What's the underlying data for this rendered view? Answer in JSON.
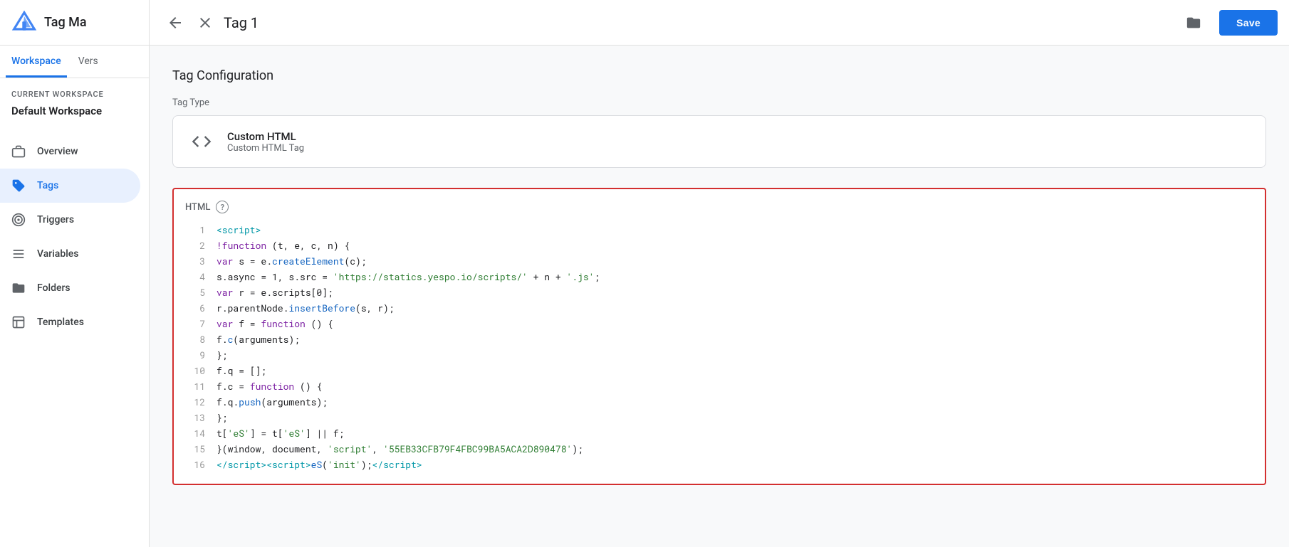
{
  "app": {
    "title": "Tag Ma",
    "logo_alt": "Google Tag Manager"
  },
  "sidebar": {
    "workspace_label": "CURRENT WORKSPACE",
    "workspace_name": "Default Workspace",
    "tabs": [
      {
        "id": "workspace",
        "label": "Workspace",
        "active": true
      },
      {
        "id": "versions",
        "label": "Vers",
        "active": false
      }
    ],
    "nav_items": [
      {
        "id": "overview",
        "label": "Overview",
        "icon": "briefcase",
        "active": false
      },
      {
        "id": "tags",
        "label": "Tags",
        "icon": "tag",
        "active": true
      },
      {
        "id": "triggers",
        "label": "Triggers",
        "icon": "target",
        "active": false
      },
      {
        "id": "variables",
        "label": "Variables",
        "icon": "list",
        "active": false
      },
      {
        "id": "folders",
        "label": "Folders",
        "icon": "folder",
        "active": false
      },
      {
        "id": "templates",
        "label": "Templates",
        "icon": "template",
        "active": false
      }
    ]
  },
  "header": {
    "tag_name": "Tag 1",
    "save_label": "Save"
  },
  "tag_config": {
    "section_title": "Tag Configuration",
    "field_label": "Tag Type",
    "type_name": "Custom HTML",
    "type_sub": "Custom HTML Tag"
  },
  "html_section": {
    "label": "HTML",
    "help": "?",
    "code_lines": [
      {
        "num": 1,
        "html": "<span class='c-tag'>&lt;script&gt;</span>"
      },
      {
        "num": 2,
        "html": "<span class='c-plain'>    </span><span class='c-keyword'>!function</span><span class='c-plain'> (t, e, c, n) {</span>"
      },
      {
        "num": 3,
        "html": "<span class='c-plain'>        </span><span class='c-keyword'>var</span><span class='c-plain'> s = e.</span><span class='c-func'>createElement</span><span class='c-plain'>(c);</span>"
      },
      {
        "num": 4,
        "html": "<span class='c-plain'>        s.async = 1, s.src = </span><span class='c-string'>'https://statics.yespo.io/scripts/'</span><span class='c-plain'> + n + </span><span class='c-string'>'.js'</span><span class='c-plain'>;</span>"
      },
      {
        "num": 5,
        "html": "<span class='c-plain'>        </span><span class='c-keyword'>var</span><span class='c-plain'> r = e.scripts[0];</span>"
      },
      {
        "num": 6,
        "html": "<span class='c-plain'>        r.parentNode.</span><span class='c-func'>insertBefore</span><span class='c-plain'>(s, r);</span>"
      },
      {
        "num": 7,
        "html": "<span class='c-plain'>        </span><span class='c-keyword'>var</span><span class='c-plain'> f = </span><span class='c-keyword'>function</span><span class='c-plain'> () {</span>"
      },
      {
        "num": 8,
        "html": "<span class='c-plain'>            f.</span><span class='c-func'>c</span><span class='c-plain'>(arguments);</span>"
      },
      {
        "num": 9,
        "html": "<span class='c-plain'>        };</span>"
      },
      {
        "num": 10,
        "html": "<span class='c-plain'>        f.q = [];</span>"
      },
      {
        "num": 11,
        "html": "<span class='c-plain'>        f.c = </span><span class='c-keyword'>function</span><span class='c-plain'> () {</span>"
      },
      {
        "num": 12,
        "html": "<span class='c-plain'>            f.q.</span><span class='c-func'>push</span><span class='c-plain'>(arguments);</span>"
      },
      {
        "num": 13,
        "html": "<span class='c-plain'>        };</span>"
      },
      {
        "num": 14,
        "html": "<span class='c-plain'>        t[</span><span class='c-string'>'eS'</span><span class='c-plain'>] = t[</span><span class='c-string'>'eS'</span><span class='c-plain'>] || f;</span>"
      },
      {
        "num": 15,
        "html": "<span class='c-plain'>    }(window, document, </span><span class='c-string'>'script'</span><span class='c-plain'>, </span><span class='c-string'>'55EB33CFB79F4FBC99BA5ACA2D890478'</span><span class='c-plain'>);</span>"
      },
      {
        "num": 16,
        "html": "<span class='c-tag'>&lt;/script&gt;</span><span class='c-tag'>&lt;script&gt;</span><span class='c-func'>eS</span><span class='c-plain'>(</span><span class='c-string'>'init'</span><span class='c-plain'>);</span><span class='c-tag'>&lt;/script&gt;</span>"
      }
    ]
  }
}
